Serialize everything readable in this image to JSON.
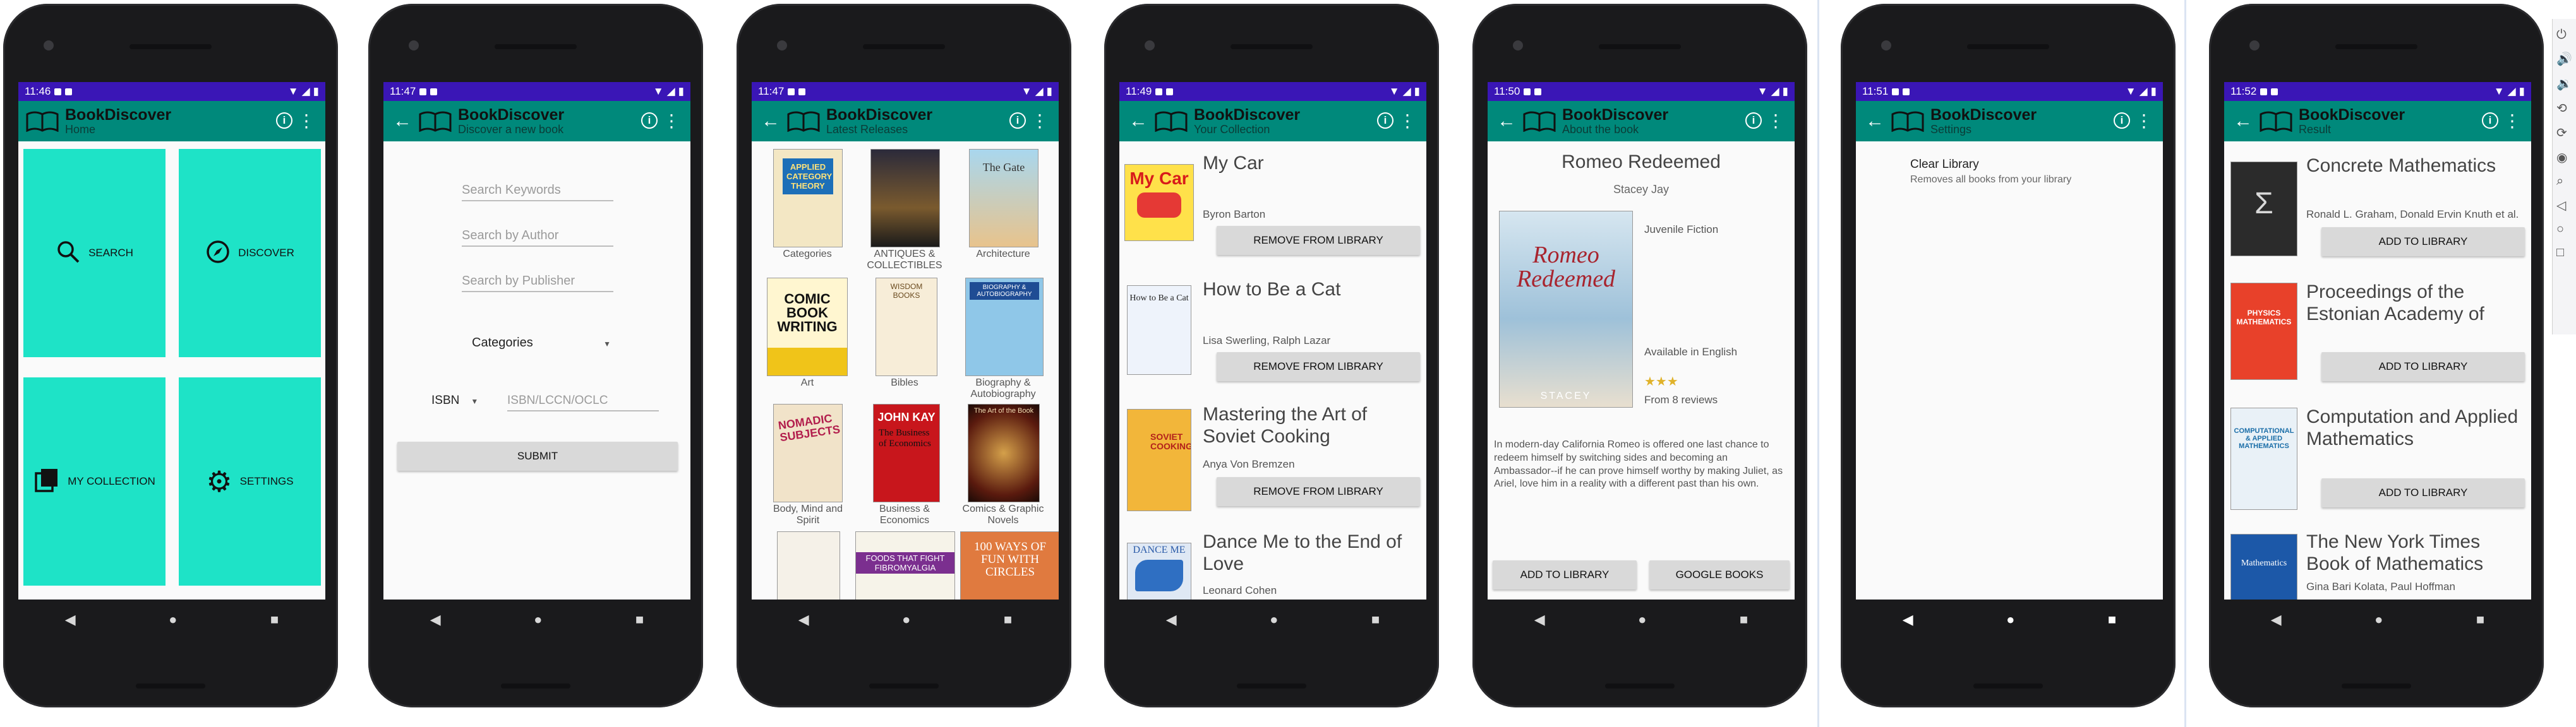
{
  "screens": [
    {
      "time": "11:46",
      "app_title": "BookDiscover",
      "subtitle": "Home",
      "tiles": [
        "SEARCH",
        "DISCOVER",
        "MY COLLECTION",
        "SETTINGS"
      ]
    },
    {
      "time": "11:47",
      "app_title": "BookDiscover",
      "subtitle": "Discover a new book",
      "search_keywords_placeholder": "Search Keywords",
      "search_author_placeholder": "Search by Author",
      "search_publisher_placeholder": "Search by Publisher",
      "categories_label": "Categories",
      "isbn_label": "ISBN",
      "isbn_placeholder": "ISBN/LCCN/OCLC",
      "submit_label": "SUBMIT"
    },
    {
      "time": "11:47",
      "app_title": "BookDiscover",
      "subtitle": "Latest Releases",
      "categories": [
        "Categories",
        "ANTIQUES & COLLECTIBLES",
        "Architecture",
        "Art",
        "Bibles",
        "Biography & Autobiography",
        "Body, Mind and Spirit",
        "Business & Economics",
        "Comics & Graphic Novels"
      ],
      "cover_texts": {
        "applied": "APPLIED CATEGORY THEORY",
        "gate": "The Gate",
        "comic": "COMIC BOOK WRITING",
        "wisdom": "WISDOM BOOKS",
        "bio": "BIOGRAPHY & AUTOBIOGRAPHY",
        "subjects": "NOMADIC SUBJECTS",
        "john_kay": "JOHN KAY",
        "economics": "The Business of Economics",
        "art_of_book": "The Art of the Book",
        "fibro": "FOODS THAT FIGHT FIBROMYALGIA",
        "hundred": "100 WAYS OF FUN WITH CIRCLES"
      }
    },
    {
      "time": "11:49",
      "app_title": "BookDiscover",
      "subtitle": "Your Collection",
      "books": [
        {
          "title": "My Car",
          "author": "Byron Barton",
          "button": "REMOVE FROM LIBRARY"
        },
        {
          "title": "How to Be a Cat",
          "author": "Lisa Swerling, Ralph Lazar",
          "button": "REMOVE FROM LIBRARY"
        },
        {
          "title": "Mastering the Art of Soviet Cooking",
          "author": "Anya Von Bremzen",
          "button": "REMOVE FROM LIBRARY"
        },
        {
          "title": "Dance Me to the End of Love",
          "author": "Leonard Cohen"
        }
      ],
      "cover_texts": {
        "mycar": "My Car",
        "howcat": "How to Be a Cat",
        "soviet": "SOVIET COOKING",
        "dance": "DANCE ME"
      }
    },
    {
      "time": "11:50",
      "app_title": "BookDiscover",
      "subtitle": "About the book",
      "book_title": "Romeo Redeemed",
      "author": "Stacey Jay",
      "genre": "Juvenile Fiction",
      "language": "Available in English",
      "rating": 3,
      "stars": "★★★",
      "reviews": "From 8 reviews",
      "cover_title": "Romeo Redeemed",
      "cover_author": "STACEY",
      "description": "In modern-day California Romeo is offered one last chance to redeem himself by switching sides and becoming an Ambassador--if he can prove himself worthy by making Juliet, as Ariel, love him in a reality with a different past than his own.",
      "add_label": "ADD TO LIBRARY",
      "google_label": "GOOGLE BOOKS"
    },
    {
      "time": "11:51",
      "app_title": "BookDiscover",
      "subtitle": "Settings",
      "setting_title": "Clear Library",
      "setting_desc": "Removes all books from your library"
    },
    {
      "time": "11:52",
      "app_title": "BookDiscover",
      "subtitle": "Result",
      "books": [
        {
          "title": "Concrete Mathematics",
          "author": "Ronald L. Graham, Donald Ervin Knuth et al.",
          "button": "ADD TO LIBRARY"
        },
        {
          "title": "Proceedings of the Estonian Academy of",
          "author": "",
          "button": "ADD TO LIBRARY"
        },
        {
          "title": "Computation and Applied Mathematics",
          "author": "",
          "button": "ADD TO LIBRARY"
        },
        {
          "title": "The New York Times Book of Mathematics",
          "author": "Gina Bari Kolata, Paul Hoffman"
        }
      ],
      "cover_texts": {
        "sigma": "Σ",
        "physics": "PHYSICS MATHEMATICS",
        "comp": "COMPUTATIONAL & APPLIED MATHEMATICS",
        "nyt": "Mathematics"
      }
    }
  ],
  "colors": {
    "status_bar": "#3a16b6",
    "app_bar": "#00897b",
    "tile": "#1ee3c7",
    "button": "#d9d9d9"
  }
}
